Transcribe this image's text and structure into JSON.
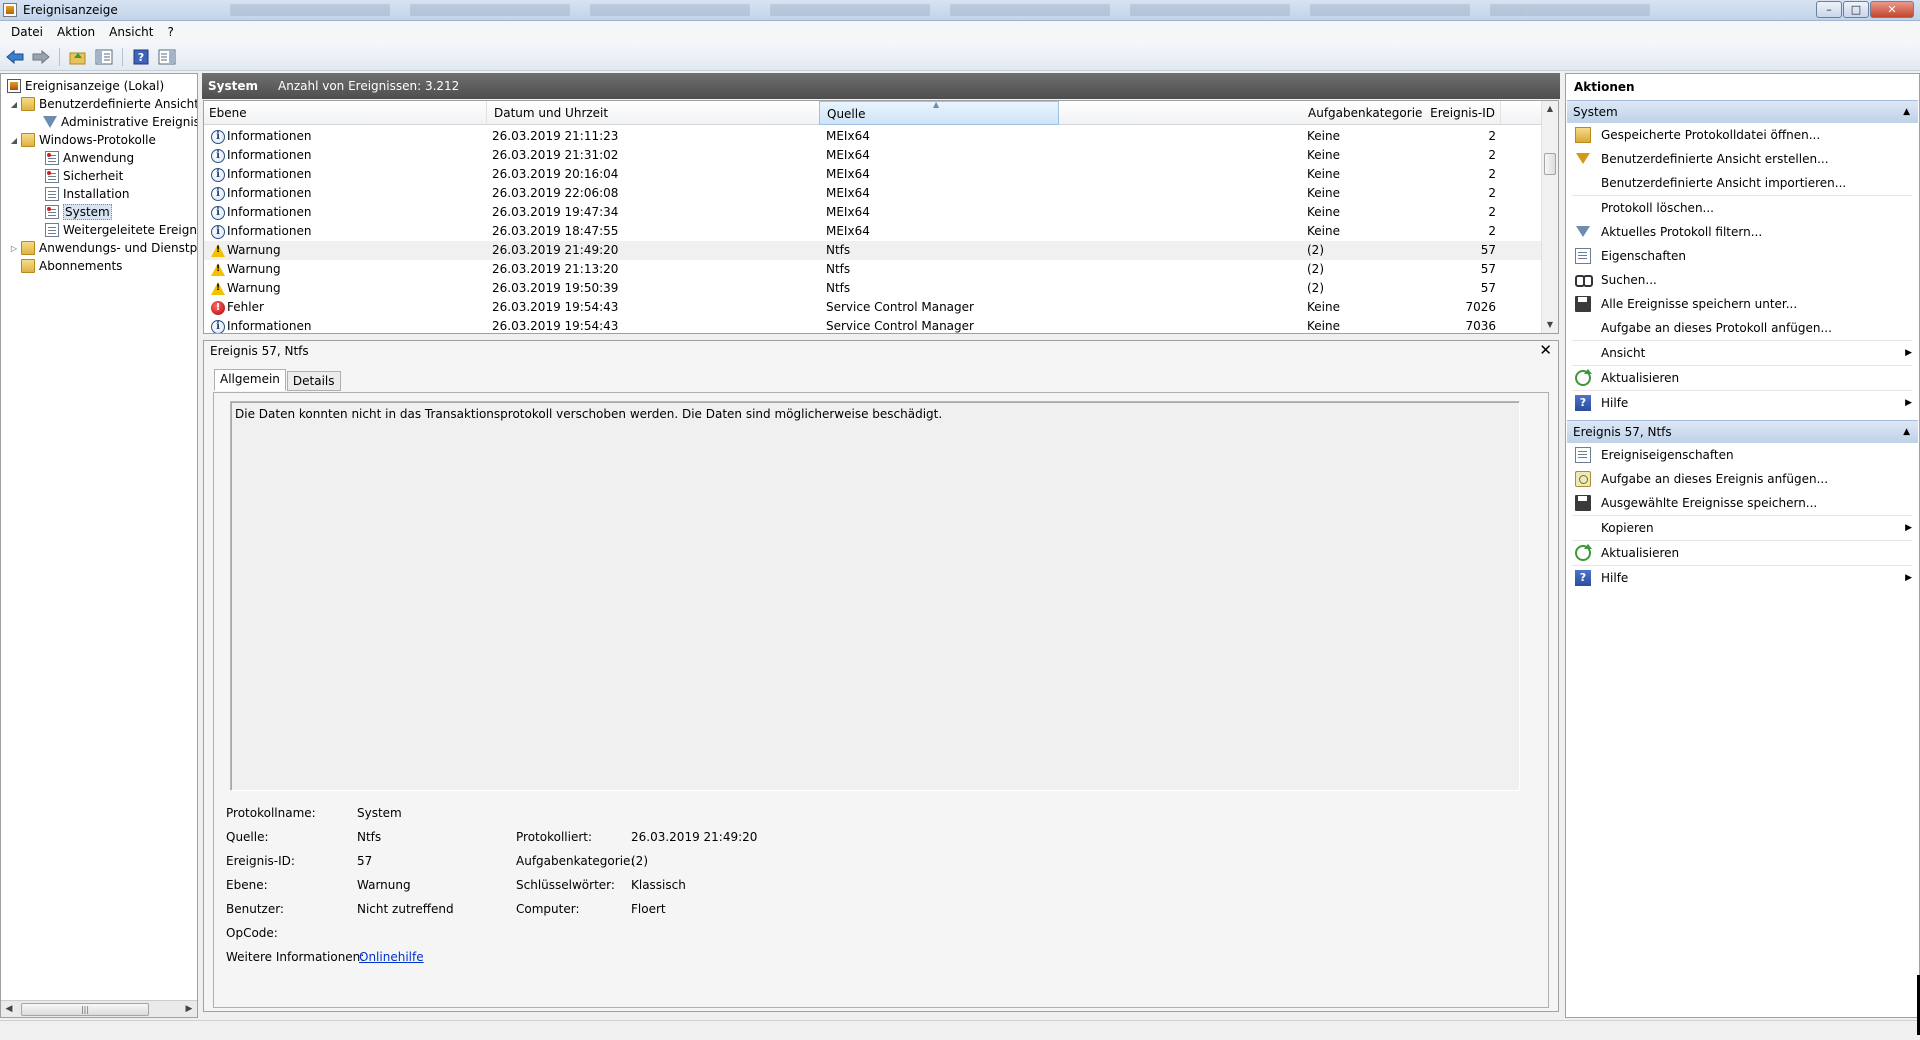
{
  "window": {
    "title": "Ereignisanzeige"
  },
  "menu": [
    "Datei",
    "Aktion",
    "Ansicht",
    "?"
  ],
  "toolbar": [
    "back-icon",
    "forward-icon",
    "up-folder-icon",
    "show-hide-tree-icon",
    "help-icon",
    "show-hide-actions-icon"
  ],
  "tree": {
    "root": "Ereignisanzeige (Lokal)",
    "custom_views": "Benutzerdefinierte Ansichten",
    "admin_events": "Administrative Ereignisse",
    "windows_logs": "Windows-Protokolle",
    "application": "Anwendung",
    "security": "Sicherheit",
    "setup": "Installation",
    "system": "System",
    "forwarded": "Weitergeleitete Ereignisse",
    "apps_services": "Anwendungs- und Dienstprotokolle",
    "subscriptions": "Abonnements"
  },
  "log_header": {
    "name": "System",
    "count": "Anzahl von Ereignissen: 3.212"
  },
  "columns": {
    "level": "Ebene",
    "datetime": "Datum und Uhrzeit",
    "source": "Quelle",
    "event_id": "Ereignis-ID",
    "task": "Aufgabenkategorie"
  },
  "events": [
    {
      "level": "Informationen",
      "icon": "info",
      "datetime": "26.03.2019 21:11:23",
      "source": "MEIx64",
      "id": "2",
      "task": "Keine"
    },
    {
      "level": "Informationen",
      "icon": "info",
      "datetime": "26.03.2019 21:31:02",
      "source": "MEIx64",
      "id": "2",
      "task": "Keine"
    },
    {
      "level": "Informationen",
      "icon": "info",
      "datetime": "26.03.2019 20:16:04",
      "source": "MEIx64",
      "id": "2",
      "task": "Keine"
    },
    {
      "level": "Informationen",
      "icon": "info",
      "datetime": "26.03.2019 22:06:08",
      "source": "MEIx64",
      "id": "2",
      "task": "Keine"
    },
    {
      "level": "Informationen",
      "icon": "info",
      "datetime": "26.03.2019 19:47:34",
      "source": "MEIx64",
      "id": "2",
      "task": "Keine"
    },
    {
      "level": "Informationen",
      "icon": "info",
      "datetime": "26.03.2019 18:47:55",
      "source": "MEIx64",
      "id": "2",
      "task": "Keine"
    },
    {
      "level": "Warnung",
      "icon": "warning",
      "datetime": "26.03.2019 21:49:20",
      "source": "Ntfs",
      "id": "57",
      "task": "(2)"
    },
    {
      "level": "Warnung",
      "icon": "warning",
      "datetime": "26.03.2019 21:13:20",
      "source": "Ntfs",
      "id": "57",
      "task": "(2)"
    },
    {
      "level": "Warnung",
      "icon": "warning",
      "datetime": "26.03.2019 19:50:39",
      "source": "Ntfs",
      "id": "57",
      "task": "(2)"
    },
    {
      "level": "Fehler",
      "icon": "error",
      "datetime": "26.03.2019 19:54:43",
      "source": "Service Control Manager",
      "id": "7026",
      "task": "Keine"
    },
    {
      "level": "Informationen",
      "icon": "info",
      "datetime": "26.03.2019 19:54:43",
      "source": "Service Control Manager",
      "id": "7036",
      "task": "Keine"
    }
  ],
  "detail": {
    "title": "Ereignis 57, Ntfs",
    "tabs": [
      "Allgemein",
      "Details"
    ],
    "message": "Die Daten konnten nicht in das Transaktionsprotokoll verschoben werden. Die Daten sind möglicherweise beschädigt.",
    "labels": {
      "log_name": "Protokollname:",
      "source": "Quelle:",
      "event_id": "Ereignis-ID:",
      "level": "Ebene:",
      "user": "Benutzer:",
      "opcode": "OpCode:",
      "more_info": "Weitere Informationen:",
      "logged": "Protokolliert:",
      "task": "Aufgabenkategorie:",
      "keywords": "Schlüsselwörter:",
      "computer": "Computer:"
    },
    "values": {
      "log_name": "System",
      "source": "Ntfs",
      "event_id": "57",
      "level": "Warnung",
      "user": "Nicht zutreffend",
      "opcode": "",
      "more_info": "Onlinehilfe",
      "logged": "26.03.2019 21:49:20",
      "task": "(2)",
      "keywords": "Klassisch",
      "computer": "Floert"
    }
  },
  "actions": {
    "title": "Aktionen",
    "system_section": "System",
    "system_items": [
      "Gespeicherte Protokolldatei öffnen...",
      "Benutzerdefinierte Ansicht erstellen...",
      "Benutzerdefinierte Ansicht importieren...",
      "Protokoll löschen...",
      "Aktuelles Protokoll filtern...",
      "Eigenschaften",
      "Suchen...",
      "Alle Ereignisse speichern unter...",
      "Aufgabe an dieses Protokoll anfügen...",
      "Ansicht",
      "Aktualisieren",
      "Hilfe"
    ],
    "event_section": "Ereignis 57, Ntfs",
    "event_items": [
      "Ereigniseigenschaften",
      "Aufgabe an dieses Ereignis anfügen...",
      "Ausgewählte Ereignisse speichern...",
      "Kopieren",
      "Aktualisieren",
      "Hilfe"
    ]
  }
}
